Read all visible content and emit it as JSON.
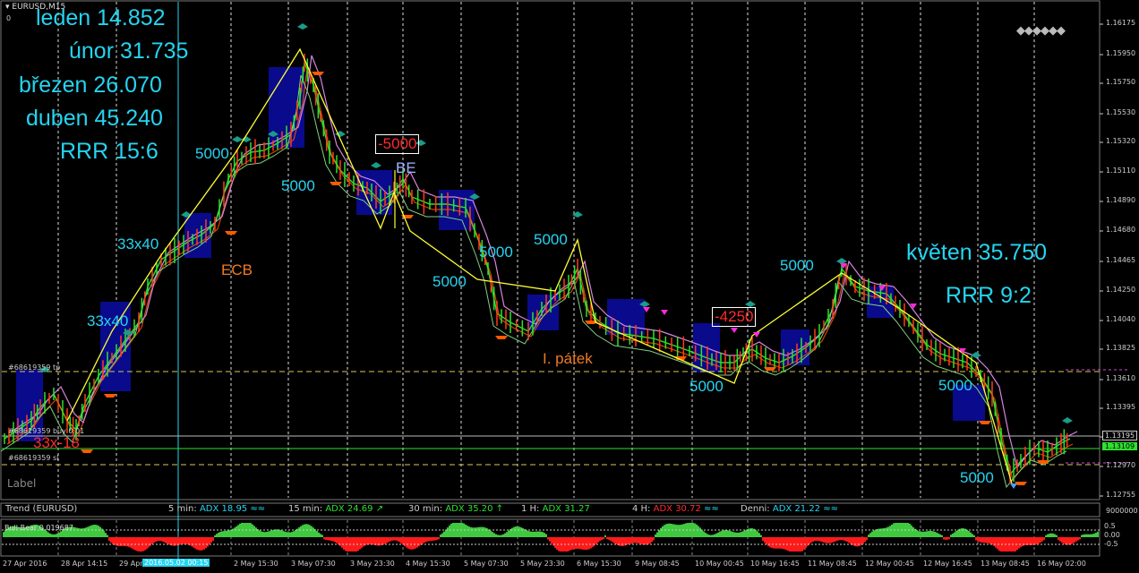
{
  "window": {
    "symbol": "EURUSD,M15",
    "zero_label": "0"
  },
  "stats": [
    {
      "text": "leden 14.852"
    },
    {
      "text": "únor 31.735"
    },
    {
      "text": "březen 26.070"
    },
    {
      "text": "duben 45.240"
    },
    {
      "text": "RRR 15:6"
    }
  ],
  "may_stats": {
    "line1": "květen 35.750",
    "line2": "RRR 9:2"
  },
  "annotations": {
    "labels_5000": "5000",
    "label_33x40": "33x40",
    "label_ecb": "ECB",
    "label_friday": "I. pátek",
    "loss1": "-5000",
    "loss2": "-4250",
    "be": "BE",
    "label_33x18": "33x-18",
    "label_text": "Label"
  },
  "order_labels": {
    "tp": "#68619359 tp",
    "buy": "#68619359 buy 0.01",
    "sl": "#68619359 sl"
  },
  "price_axis": {
    "ticks": [
      "1.16175",
      "1.15950",
      "1.15750",
      "1.15530",
      "1.15320",
      "1.15110",
      "1.14890",
      "1.14680",
      "1.14465",
      "1.14250",
      "1.14040",
      "1.13825",
      "1.13610",
      "1.13395",
      "1.13195",
      "1.12970",
      "1.12755"
    ],
    "current_price": "1.13109",
    "upper_marker": "1.13195"
  },
  "time_axis": {
    "ticks": [
      "27 Apr 2016",
      "28 Apr 14:15",
      "29 Apr",
      "2 May 15:30",
      "3 May 07:30",
      "3 May 23:30",
      "4 May 15:30",
      "5 May 07:30",
      "5 May 23:30",
      "6 May 15:30",
      "9 May 08:45",
      "10 May 00:45",
      "10 May 16:45",
      "11 May 08:45",
      "12 May 00:45",
      "12 May 16:45",
      "13 May 08:45",
      "16 May 02:00"
    ],
    "highlight": "2016.05.02 00:15"
  },
  "trend_panel": {
    "title": "Trend (EURUSD)",
    "items": [
      {
        "tf": "5 min:",
        "value": "ADX 18.95",
        "arrow": "≈≈",
        "color": "#25d4f0"
      },
      {
        "tf": "15 min:",
        "value": "ADX 24.69",
        "arrow": "↗",
        "color": "#2ee02e"
      },
      {
        "tf": "30 min:",
        "value": "ADX 35.20",
        "arrow": "↑",
        "color": "#2ee02e"
      },
      {
        "tf": "1 H:",
        "value": "ADX 31.27",
        "arrow": "",
        "color": "#2ee02e"
      },
      {
        "tf": "4 H:",
        "value": "ADX 30.72",
        "arrow": "≈≈",
        "color": "#ff2a2a"
      },
      {
        "tf": "Denni:",
        "value": "ADX 21.22",
        "arrow": "≈≈",
        "color": "#25d4f0"
      }
    ],
    "scale_top": "9000000"
  },
  "bull_bear": {
    "label": "Bull-Bear 0.019687",
    "scale": [
      "0.5",
      "0.00",
      "-0.5"
    ]
  },
  "colors": {
    "bull": "#3fc93f",
    "bear": "#ff1a1a",
    "cyan": "#25d4f0",
    "price_line": "#2ee02e",
    "zigzag": "#ffff33"
  },
  "chart_data": {
    "type": "line",
    "title": "EURUSD,M15",
    "x": [
      "27 Apr 2016",
      "28 Apr 14:15",
      "29 Apr",
      "2 May 15:30",
      "3 May 07:30",
      "3 May 23:30",
      "4 May 15:30",
      "5 May 07:30",
      "5 May 23:30",
      "6 May 15:30",
      "9 May 08:45",
      "10 May 00:45",
      "10 May 16:45",
      "11 May 08:45",
      "12 May 00:45",
      "12 May 16:45",
      "13 May 08:45",
      "16 May 02:00"
    ],
    "series": [
      {
        "values": [
          1.1315,
          1.137,
          1.146,
          1.152,
          1.158,
          1.151,
          1.148,
          1.145,
          1.141,
          1.142,
          1.138,
          1.138,
          1.139,
          1.143,
          1.142,
          1.138,
          1.131,
          1.131
        ]
      }
    ],
    "ylim": [
      1.12755,
      1.16175
    ],
    "grid": true
  }
}
